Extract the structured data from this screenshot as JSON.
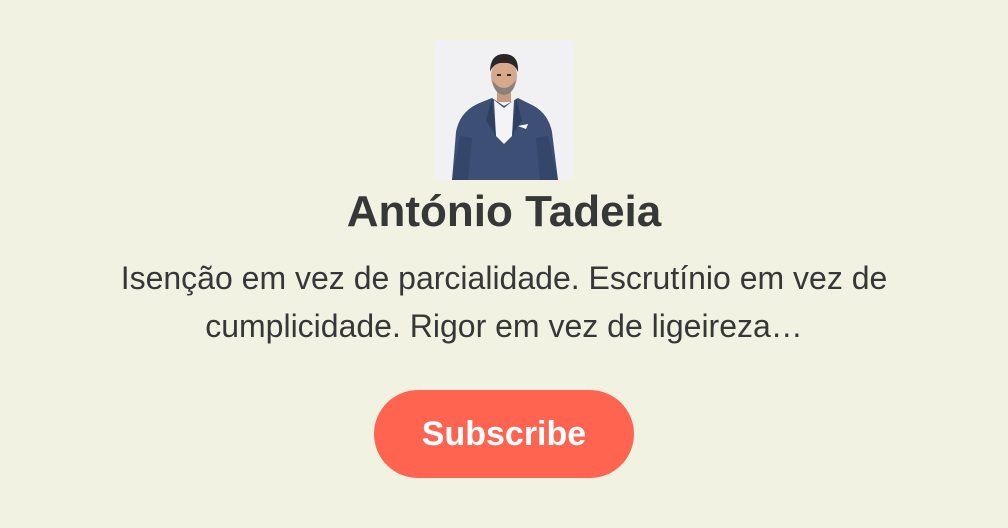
{
  "profile": {
    "name": "António Tadeia",
    "description": "Isenção em vez de parcialidade. Escrutínio em vez de cumplicidade. Rigor em vez de ligeireza…",
    "avatar": "author-portrait-photo"
  },
  "actions": {
    "subscribe_label": "Subscribe"
  },
  "colors": {
    "background": "#f2f2e2",
    "text": "#363737",
    "button": "#ff6451",
    "button_text": "#ffffff"
  }
}
